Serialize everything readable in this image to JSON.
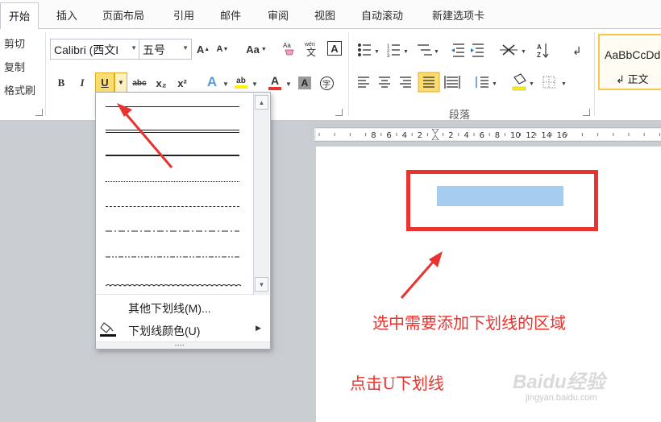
{
  "tabs": [
    "开始",
    "插入",
    "页面布局",
    "引用",
    "邮件",
    "审阅",
    "视图",
    "自动滚动",
    "新建选项卡"
  ],
  "clipboard": {
    "cut": "剪切",
    "copy": "复制",
    "format_painter": "格式刷"
  },
  "font": {
    "name": "Calibri (西文I",
    "size": "五号",
    "grow": "A",
    "shrink": "A",
    "case": "Aa",
    "bold": "B",
    "italic": "I",
    "underline": "U",
    "strikethrough": "abc",
    "subscript": "x₂",
    "superscript": "x²",
    "highlight": "ab",
    "font_color": "A",
    "char_shading": "A",
    "enclose": "字"
  },
  "paragraph": {
    "group_label": "段落"
  },
  "styles": {
    "preview": "AaBbCcDd",
    "normal": "正文"
  },
  "ruler_numbers": [
    "8",
    "6",
    "4",
    "2",
    "2",
    "4",
    "6",
    "8",
    "10",
    "12",
    "14",
    "16"
  ],
  "underline_menu": {
    "more_underlines": "其他下划线(M)...",
    "underline_color": "下划线颜色(U)"
  },
  "annotations": {
    "select_region": "选中需要添加下划线的区域",
    "click_u": "点击U下划线"
  },
  "watermark": {
    "brand": "Baidu经验",
    "url": "jingyan.baidu.com"
  },
  "colors": {
    "highlight_box": "#e8332f",
    "selection": "#a6cdf0",
    "pressed_button": "#fbdc6f"
  }
}
